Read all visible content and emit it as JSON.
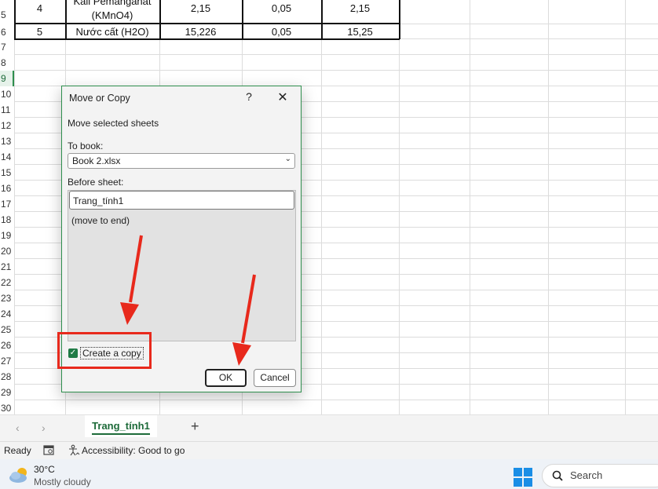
{
  "grid": {
    "row_numbers": [
      "5",
      "6",
      "7",
      "8",
      "9",
      "10",
      "11",
      "12",
      "13",
      "14",
      "15",
      "16",
      "17",
      "18",
      "19",
      "20",
      "21",
      "22",
      "23",
      "24",
      "25",
      "26",
      "27",
      "28",
      "29",
      "30"
    ],
    "selected_row": "9",
    "rows": [
      {
        "stt": "4",
        "name_line1": "Kali Pemanganat",
        "name_line2": "(KMnO4)",
        "c1": "2,15",
        "c2": "0,05",
        "c3": "2,15"
      },
      {
        "stt": "5",
        "name": "Nước cất (H2O)",
        "c1": "15,226",
        "c2": "0,05",
        "c3": "15,25"
      }
    ]
  },
  "dialog": {
    "title": "Move or Copy",
    "help": "?",
    "close": "✕",
    "subtitle": "Move selected sheets",
    "to_book_label": "To book:",
    "to_book_value": "Book 2.xlsx",
    "before_sheet_label": "Before sheet:",
    "sheets": [
      "Trang_tính1",
      "(move to end)"
    ],
    "create_copy_label": "Create a copy",
    "create_copy_checked": true,
    "ok_label": "OK",
    "cancel_label": "Cancel"
  },
  "tabs": {
    "prev": "‹",
    "next": "›",
    "sheet": "Trang_tính1",
    "add": "+"
  },
  "status": {
    "ready": "Ready",
    "accessibility": "Accessibility: Good to go"
  },
  "taskbar": {
    "temp": "30°C",
    "weather": "Mostly cloudy",
    "search": "Search"
  },
  "colors": {
    "accent": "#1e6b3a",
    "annotation_red": "#e8291c"
  }
}
